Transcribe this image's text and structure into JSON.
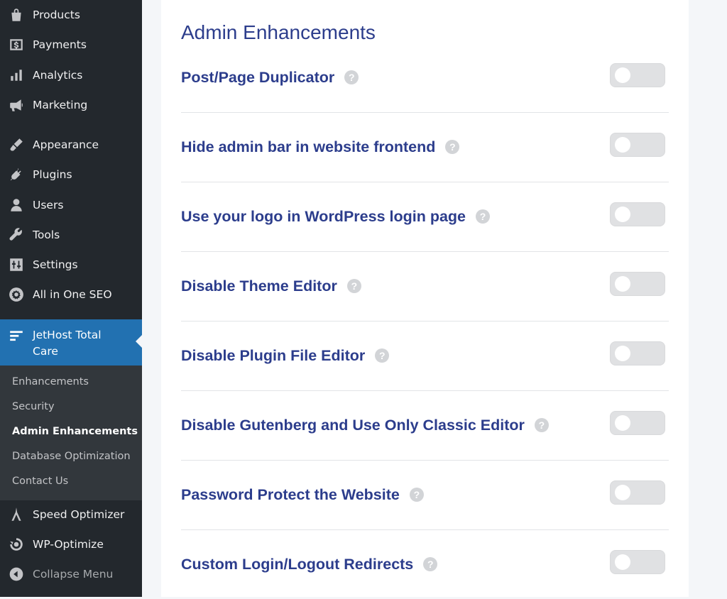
{
  "sidebar": {
    "items": [
      {
        "label": "Products",
        "icon": "bag-icon"
      },
      {
        "label": "Payments",
        "icon": "dollar-icon"
      },
      {
        "label": "Analytics",
        "icon": "bar-chart-icon"
      },
      {
        "label": "Marketing",
        "icon": "megaphone-icon"
      },
      {
        "label": "Appearance",
        "icon": "brush-icon"
      },
      {
        "label": "Plugins",
        "icon": "plug-icon"
      },
      {
        "label": "Users",
        "icon": "user-icon"
      },
      {
        "label": "Tools",
        "icon": "wrench-icon"
      },
      {
        "label": "Settings",
        "icon": "sliders-icon"
      },
      {
        "label": "All in One SEO",
        "icon": "gear-icon"
      }
    ],
    "active": {
      "label": "JetHost Total Care",
      "icon": "lines-icon"
    },
    "submenu": [
      "Enhancements",
      "Security",
      "Admin Enhancements",
      "Database Optimization",
      "Contact Us"
    ],
    "submenu_current": "Admin Enhancements",
    "after": [
      {
        "label": "Speed Optimizer",
        "icon": "tower-icon"
      },
      {
        "label": "WP-Optimize",
        "icon": "optimize-icon"
      }
    ],
    "collapse": "Collapse Menu"
  },
  "main": {
    "title": "Admin Enhancements",
    "settings": [
      {
        "label": "Post/Page Duplicator",
        "enabled": false
      },
      {
        "label": "Hide admin bar in website frontend",
        "enabled": false
      },
      {
        "label": "Use your logo in WordPress login page",
        "enabled": false
      },
      {
        "label": "Disable Theme Editor",
        "enabled": false
      },
      {
        "label": "Disable Plugin File Editor",
        "enabled": false
      },
      {
        "label": "Disable Gutenberg and Use Only Classic Editor",
        "enabled": false
      },
      {
        "label": "Password Protect the Website",
        "enabled": false
      },
      {
        "label": "Custom Login/Logout Redirects",
        "enabled": false
      }
    ],
    "help_glyph": "?"
  },
  "colors": {
    "sidebar_bg": "#23282d",
    "active_bg": "#2271b1",
    "heading": "#2c3d8c",
    "toggle_off": "#e0e1e3"
  }
}
